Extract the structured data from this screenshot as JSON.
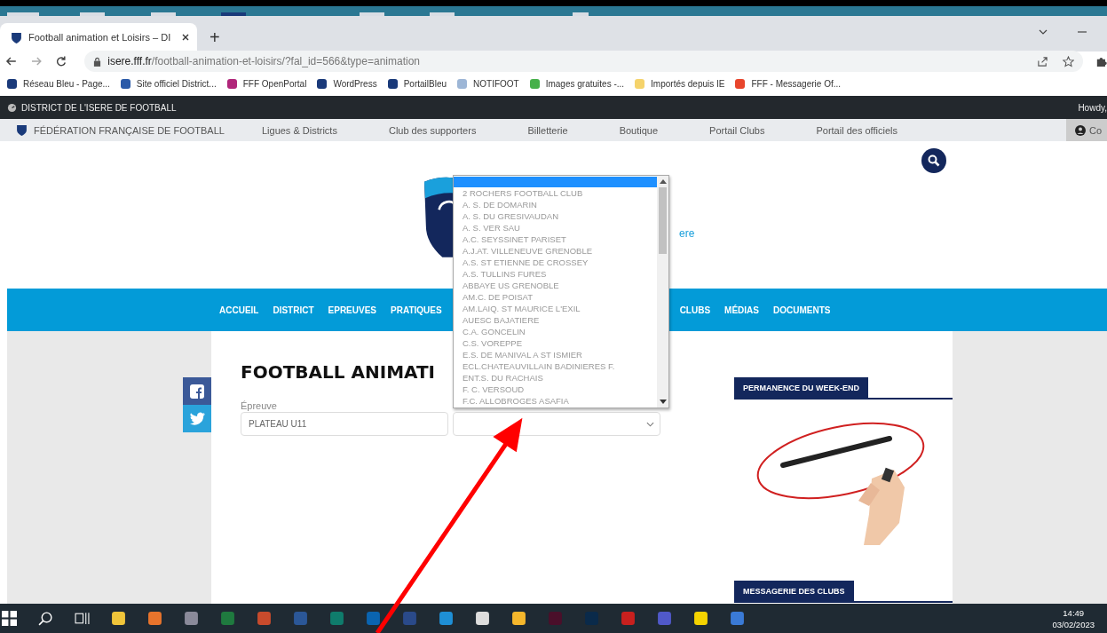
{
  "browser": {
    "tab_title": "Football animation et Loisirs – DI",
    "new_tab": "+",
    "address_domain": "isere.fff.fr",
    "address_path": "/football-animation-et-loisirs/?fal_id=566&type=animation",
    "bookmarks": [
      "Réseau Bleu - Page...",
      "Site officiel District...",
      "FFF OpenPortal",
      "WordPress",
      "PortailBleu",
      "NOTIFOOT",
      "Images gratuites -...",
      "Importés depuis IE",
      "FFF - Messagerie Of..."
    ]
  },
  "admin_bar": {
    "site": "DISTRICT DE L'ISERE DE FOOTBALL",
    "greeting": "Howdy,"
  },
  "fff_bar": {
    "brand": "FÉDÉRATION FRANÇAISE DE FOOTBALL",
    "links": [
      "Ligues & Districts",
      "Club des supporters",
      "Billetterie",
      "Boutique",
      "Portail Clubs",
      "Portail des officiels"
    ],
    "account": "Co"
  },
  "header": {
    "site_title": "ere"
  },
  "nav": {
    "left": [
      "ACCUEIL",
      "DISTRICT",
      "EPREUVES",
      "PRATIQUES"
    ],
    "right": [
      "CLUBS",
      "MÉDIAS",
      "DOCUMENTS"
    ]
  },
  "main": {
    "title": "FOOTBALL ANIMATI",
    "field_label": "Épreuve",
    "field_value": "PLATEAU U11"
  },
  "dropdown": {
    "blank_highlighted": true,
    "options": [
      {
        "label": "2 ROCHERS FOOTBALL CLUB",
        "selected": false
      },
      {
        "label": "A. S. DE DOMARIN",
        "selected": false
      },
      {
        "label": "A. S. DU GRESIVAUDAN",
        "selected": false
      },
      {
        "label": "A. S. VER SAU",
        "selected": false
      },
      {
        "label": "A.C. SEYSSINET PARISET",
        "selected": false
      },
      {
        "label": "A.J.AT. VILLENEUVE GRENOBLE",
        "selected": false
      },
      {
        "label": "A.S. ST ETIENNE DE CROSSEY",
        "selected": false
      },
      {
        "label": "A.S. TULLINS FURES",
        "selected": false
      },
      {
        "label": "ABBAYE US GRENOBLE",
        "selected": false
      },
      {
        "label": "AM.C. DE POISAT",
        "selected": false
      },
      {
        "label": "AM.LAIQ. ST MAURICE L'EXIL",
        "selected": false
      },
      {
        "label": "AUESC BAJATIERE",
        "selected": false
      },
      {
        "label": "C.A. GONCELIN",
        "selected": false
      },
      {
        "label": "C.S. VOREPPE",
        "selected": false
      },
      {
        "label": "E.S. DE MANIVAL A ST ISMIER",
        "selected": false
      },
      {
        "label": "ECL.CHATEAUVILLAIN BADINIERES F.",
        "selected": false
      },
      {
        "label": "ENT.S. DU RACHAIS",
        "selected": false
      },
      {
        "label": "F. C. VERSOUD",
        "selected": false
      },
      {
        "label": "F.C. ALLOBROGES ASAFIA",
        "selected": false
      }
    ]
  },
  "sidebar": {
    "sections": [
      {
        "title": "PERMANENCE DU WEEK-END",
        "kind": "picture"
      },
      {
        "title": "MESSAGERIE DES CLUBS"
      }
    ]
  },
  "taskbar": {
    "time": "14:49",
    "date": "03/02/2023"
  }
}
